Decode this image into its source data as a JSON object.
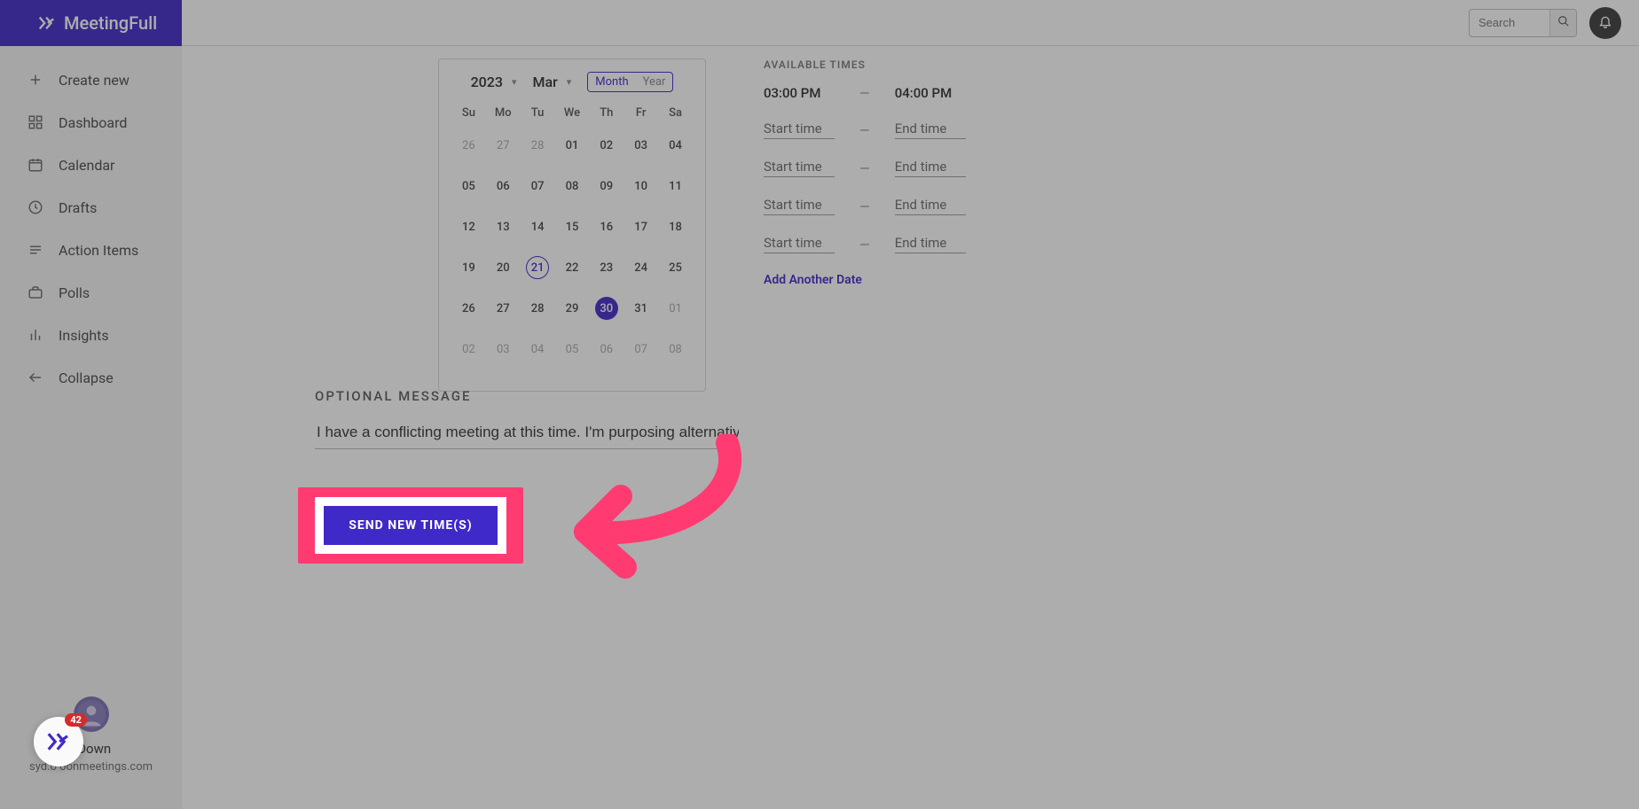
{
  "brand": {
    "name": "MeetingFull"
  },
  "topbar": {
    "search_placeholder": "Search"
  },
  "sidebar": {
    "items": [
      {
        "icon": "plus",
        "label": "Create new"
      },
      {
        "icon": "grid",
        "label": "Dashboard"
      },
      {
        "icon": "calendar",
        "label": "Calendar"
      },
      {
        "icon": "clock",
        "label": "Drafts"
      },
      {
        "icon": "list",
        "label": "Action Items"
      },
      {
        "icon": "briefcase",
        "label": "Polls"
      },
      {
        "icon": "bars",
        "label": "Insights"
      },
      {
        "icon": "arrow-left",
        "label": "Collapse"
      }
    ],
    "user": {
      "name": "l Down",
      "email": "syd.o             oonmeetings.com"
    }
  },
  "calendar": {
    "year": "2023",
    "month": "Mar",
    "view_month": "Month",
    "view_year": "Year",
    "dow": [
      "Su",
      "Mo",
      "Tu",
      "We",
      "Th",
      "Fr",
      "Sa"
    ],
    "weeks": [
      [
        {
          "d": "26",
          "o": true
        },
        {
          "d": "27",
          "o": true
        },
        {
          "d": "28",
          "o": true
        },
        {
          "d": "01"
        },
        {
          "d": "02"
        },
        {
          "d": "03"
        },
        {
          "d": "04"
        }
      ],
      [
        {
          "d": "05"
        },
        {
          "d": "06"
        },
        {
          "d": "07"
        },
        {
          "d": "08"
        },
        {
          "d": "09"
        },
        {
          "d": "10"
        },
        {
          "d": "11"
        }
      ],
      [
        {
          "d": "12"
        },
        {
          "d": "13"
        },
        {
          "d": "14"
        },
        {
          "d": "15"
        },
        {
          "d": "16"
        },
        {
          "d": "17"
        },
        {
          "d": "18"
        }
      ],
      [
        {
          "d": "19"
        },
        {
          "d": "20"
        },
        {
          "d": "21",
          "today": true
        },
        {
          "d": "22"
        },
        {
          "d": "23"
        },
        {
          "d": "24"
        },
        {
          "d": "25"
        }
      ],
      [
        {
          "d": "26"
        },
        {
          "d": "27"
        },
        {
          "d": "28"
        },
        {
          "d": "29"
        },
        {
          "d": "30",
          "sel": true
        },
        {
          "d": "31"
        },
        {
          "d": "01",
          "o": true
        }
      ],
      [
        {
          "d": "02",
          "o": true
        },
        {
          "d": "03",
          "o": true
        },
        {
          "d": "04",
          "o": true
        },
        {
          "d": "05",
          "o": true
        },
        {
          "d": "06",
          "o": true
        },
        {
          "d": "07",
          "o": true
        },
        {
          "d": "08",
          "o": true
        }
      ]
    ]
  },
  "available": {
    "heading": "AVAILABLE TIMES",
    "rows": [
      {
        "start": "03:00 PM",
        "end": "04:00 PM",
        "filled": true
      },
      {
        "start": "Start time",
        "end": "End time",
        "filled": false
      },
      {
        "start": "Start time",
        "end": "End time",
        "filled": false
      },
      {
        "start": "Start time",
        "end": "End time",
        "filled": false
      },
      {
        "start": "Start time",
        "end": "End time",
        "filled": false
      }
    ],
    "add_label": "Add Another Date",
    "dash": "—"
  },
  "optional": {
    "label": "OPTIONAL MESSAGE",
    "value": "I have a conflicting meeting at this time. I'm purposing alternativ"
  },
  "send": {
    "label": "SEND NEW TIME(S)"
  },
  "badge": {
    "count": "42"
  }
}
